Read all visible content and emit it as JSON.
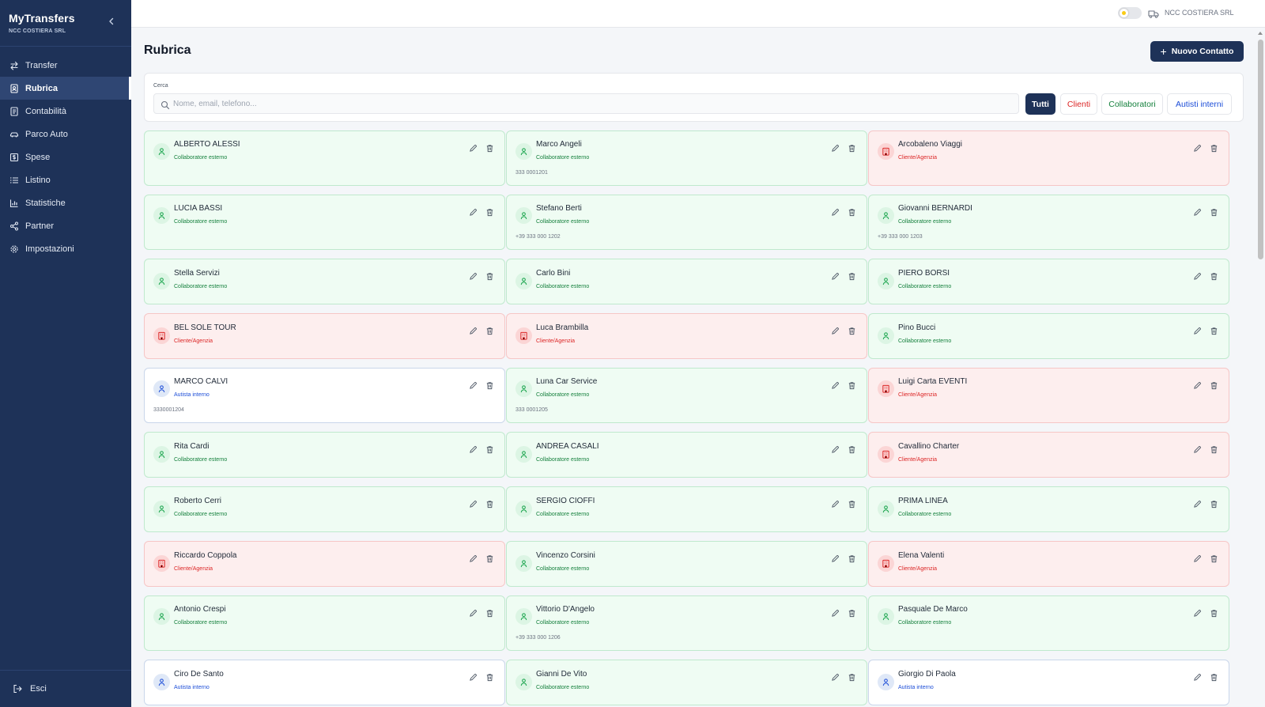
{
  "app": {
    "title": "MyTransfers",
    "subtitle": "NCC COSTIERA SRL"
  },
  "sidebar": {
    "items": [
      {
        "label": "Transfer",
        "icon": "arrows-transfer-icon",
        "active": false
      },
      {
        "label": "Rubrica",
        "icon": "address-book-icon",
        "active": true
      },
      {
        "label": "Contabilità",
        "icon": "ledger-icon",
        "active": false
      },
      {
        "label": "Parco Auto",
        "icon": "car-icon",
        "active": false
      },
      {
        "label": "Spese",
        "icon": "dollar-icon",
        "active": false
      },
      {
        "label": "Listino",
        "icon": "list-icon",
        "active": false
      },
      {
        "label": "Statistiche",
        "icon": "bar-chart-icon",
        "active": false
      },
      {
        "label": "Partner",
        "icon": "share-icon",
        "active": false
      },
      {
        "label": "Impostazioni",
        "icon": "gear-icon",
        "active": false
      }
    ],
    "logout_label": "Esci"
  },
  "topbar": {
    "company": "NCC COSTIERA SRL"
  },
  "page": {
    "title": "Rubrica",
    "new_contact_label": "Nuovo Contatto",
    "search": {
      "label": "Cerca",
      "placeholder": "Nome, email, telefono...",
      "value": ""
    },
    "filters": {
      "all": "Tutti",
      "clients": "Clienti",
      "collaborators": "Collaboratori",
      "drivers": "Autisti interni"
    }
  },
  "colors": {
    "sidebar_bg": "#1e3258",
    "primary": "#1e3258",
    "collaborator": "#15803d",
    "client": "#dc2626",
    "driver": "#1d4ed8"
  },
  "contacts": [
    {
      "name": "ALBERTO ALESSI",
      "type": "Collaboratore esterno",
      "kind": "collab",
      "phone": ""
    },
    {
      "name": "Marco Angeli",
      "type": "Collaboratore esterno",
      "kind": "collab",
      "phone": "333 0001201"
    },
    {
      "name": "Arcobaleno Viaggi",
      "type": "Cliente/Agenzia",
      "kind": "client",
      "phone": ""
    },
    {
      "name": "LUCIA BASSI",
      "type": "Collaboratore esterno",
      "kind": "collab",
      "phone": ""
    },
    {
      "name": "Stefano Berti",
      "type": "Collaboratore esterno",
      "kind": "collab",
      "phone": "+39 333 000 1202"
    },
    {
      "name": "Giovanni BERNARDI",
      "type": "Collaboratore esterno",
      "kind": "collab",
      "phone": "+39 333 000 1203"
    },
    {
      "name": "Stella Servizi",
      "type": "Collaboratore esterno",
      "kind": "collab",
      "phone": ""
    },
    {
      "name": "Carlo Bini",
      "type": "Collaboratore esterno",
      "kind": "collab",
      "phone": ""
    },
    {
      "name": "PIERO BORSI",
      "type": "Collaboratore esterno",
      "kind": "collab",
      "phone": ""
    },
    {
      "name": "BEL SOLE TOUR",
      "type": "Cliente/Agenzia",
      "kind": "client",
      "phone": ""
    },
    {
      "name": "Luca Brambilla",
      "type": "Cliente/Agenzia",
      "kind": "client",
      "phone": ""
    },
    {
      "name": "Pino Bucci",
      "type": "Collaboratore esterno",
      "kind": "collab",
      "phone": ""
    },
    {
      "name": "MARCO CALVI",
      "type": "Autista interno",
      "kind": "driver",
      "phone": "3330001204"
    },
    {
      "name": "Luna Car Service",
      "type": "Collaboratore esterno",
      "kind": "collab",
      "phone": "333 0001205"
    },
    {
      "name": "Luigi Carta EVENTI",
      "type": "Cliente/Agenzia",
      "kind": "client",
      "phone": ""
    },
    {
      "name": "Rita Cardi",
      "type": "Collaboratore esterno",
      "kind": "collab",
      "phone": ""
    },
    {
      "name": "ANDREA CASALI",
      "type": "Collaboratore esterno",
      "kind": "collab",
      "phone": ""
    },
    {
      "name": "Cavallino Charter",
      "type": "Cliente/Agenzia",
      "kind": "client",
      "phone": ""
    },
    {
      "name": "Roberto Cerri",
      "type": "Collaboratore esterno",
      "kind": "collab",
      "phone": ""
    },
    {
      "name": "SERGIO CIOFFI",
      "type": "Collaboratore esterno",
      "kind": "collab",
      "phone": ""
    },
    {
      "name": "PRIMA LINEA",
      "type": "Collaboratore esterno",
      "kind": "collab",
      "phone": ""
    },
    {
      "name": "Riccardo Coppola",
      "type": "Cliente/Agenzia",
      "kind": "client",
      "phone": ""
    },
    {
      "name": "Vincenzo Corsini",
      "type": "Collaboratore esterno",
      "kind": "collab",
      "phone": ""
    },
    {
      "name": "Elena Valenti",
      "type": "Cliente/Agenzia",
      "kind": "client",
      "phone": ""
    },
    {
      "name": "Antonio Crespi",
      "type": "Collaboratore esterno",
      "kind": "collab",
      "phone": ""
    },
    {
      "name": "Vittorio D'Angelo",
      "type": "Collaboratore esterno",
      "kind": "collab",
      "phone": "+39 333 000 1206"
    },
    {
      "name": "Pasquale De Marco",
      "type": "Collaboratore esterno",
      "kind": "collab",
      "phone": ""
    },
    {
      "name": "Ciro De Santo",
      "type": "Autista interno",
      "kind": "driver",
      "phone": ""
    },
    {
      "name": "Gianni De Vito",
      "type": "Collaboratore esterno",
      "kind": "collab",
      "phone": ""
    },
    {
      "name": "Giorgio Di Paola",
      "type": "Autista interno",
      "kind": "driver",
      "phone": ""
    }
  ]
}
